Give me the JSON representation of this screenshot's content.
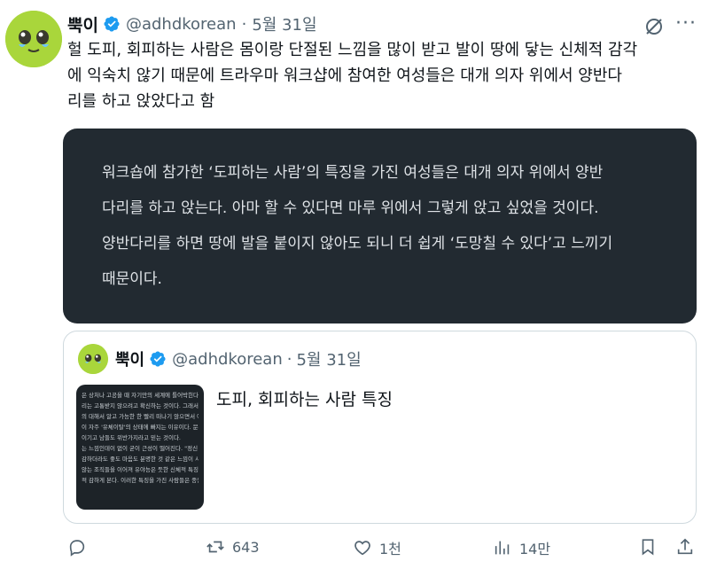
{
  "tweet": {
    "author_name": "뿍이",
    "handle": "@adhdkorean",
    "separator": "·",
    "date": "5월 31일",
    "text_lines": [
      "헐 도피, 회피하는 사람은 몸이랑 단절된 느낌을 많이 받고 발이 땅에 닿는 신체적 감각",
      "에 익숙치 않기 때문에 트라우마 워크샵에 참여한 여성들은  대개 의자 위에서 양반다",
      "리를 하고 앉았다고 함"
    ]
  },
  "image_card": {
    "lines": [
      "워크숍에 참가한 ‘도피하는 사람’의 특징을 가진 여성들은 대개 의자 위에서 양반",
      "다리를 하고 앉는다. 아마 할 수 있다면 마루 위에서 그렇게 앉고 싶었을 것이다.",
      "양반다리를 하면 땅에 발을 붙이지 않아도 되니 더 쉽게 ‘도망칠 수 있다’고 느끼기",
      " 때문이다."
    ]
  },
  "quoted_tweet": {
    "author_name": "뿍이",
    "handle": "@adhdkorean",
    "separator": "·",
    "date": "5월 31일",
    "text": "도피, 회피하는 사람 특징",
    "thumb_lines": [
      "은 상처나 고공을 때 자기만의 세계에 틀어박힌다. 가",
      "리는 고통받지 않으려고 확신하는 것이다. 그래서 여러",
      "의 대해서 알고 가능한 한 빨리 떠나기 않으면서 예민",
      "이 자주 '유체이탈'의 상태에 빠지는 이유이다. 문제는",
      "이기고 남들도 위반가지라고 믿는 것이다.",
      "",
      "는 느낌인데이 없이 굳이 근성이 떨어진다. \"정신 좀 똑바",
      "감하더라도 좋도 마음도 분명한 것 같은 느낌이 사라지",
      "않는 조직들을 이어져 유야능은 듯한 신체적 특징을 가",
      "적 감하게 본다. 이러한 특징을 가진 사람들은 종종 다"
    ]
  },
  "actions": {
    "reply_count": "",
    "retweet_count": "643",
    "like_count": "1천",
    "views_count": "14만"
  },
  "colors": {
    "accent_verified": "#1d9bf0",
    "avatar_green": "#a7d33a",
    "card_dark": "#222a31"
  }
}
